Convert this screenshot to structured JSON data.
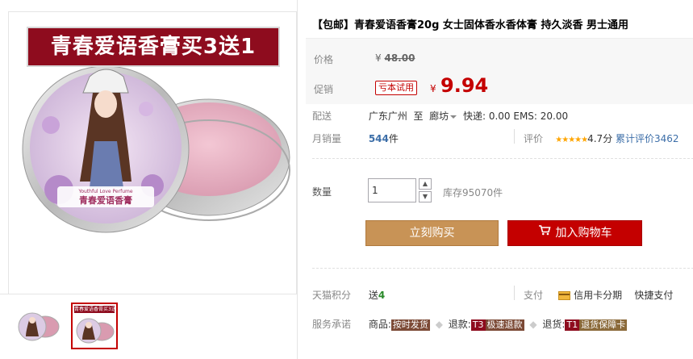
{
  "gallery": {
    "promo_banner": "青春爱语香膏买3送1",
    "thumb_banner": "青春爱语香膏买3送1",
    "tin_label_en": "Youthful Love Perfume",
    "tin_label_cn": "青春爱语香膏"
  },
  "product": {
    "title": "【包邮】青春爱语香膏20g 女士固体香水香体膏 持久淡香 男士通用"
  },
  "price": {
    "label": "价格",
    "currency": "¥",
    "original": "48.00",
    "promo_label": "促销",
    "promo_tag": "亏本试用",
    "sale": "9.94"
  },
  "delivery": {
    "label": "配送",
    "from": "广东广州",
    "to_word": "至",
    "to": "廊坊",
    "fee_text": "快递: 0.00 EMS: 20.00"
  },
  "sales": {
    "label": "月销量",
    "count": "544",
    "unit": "件",
    "rating_label": "评价",
    "stars": "★★★★★",
    "rating": "4.7分",
    "cumulative": "累计评价3462"
  },
  "quantity": {
    "label": "数量",
    "value": "1",
    "stock": "库存95070件"
  },
  "buttons": {
    "buy_now": "立刻购买",
    "add_to_cart": "加入购物车"
  },
  "points": {
    "label": "天猫积分",
    "send_word": "送",
    "value": "4",
    "pay_label": "支付",
    "credit_card": "信用卡分期",
    "quick_pay": "快捷支付"
  },
  "service": {
    "label": "服务承诺",
    "item1_prefix": "商品:",
    "item1_tag": "按时发货",
    "item2_prefix": "退款:",
    "item2_code": "T3",
    "item2_tag": "极速退款",
    "item3_prefix": "退货:",
    "item3_code": "T1",
    "item3_tag": "退货保障卡"
  },
  "colors": {
    "brand_red": "#c40000",
    "banner_red": "#8e0c1e",
    "buy_orange": "#c89356",
    "link_blue": "#3c6ea8"
  }
}
